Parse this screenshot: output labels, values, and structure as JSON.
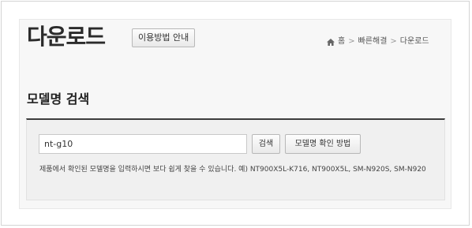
{
  "header": {
    "title": "다운로드",
    "guide_button": "이용방법 안내"
  },
  "breadcrumb": {
    "icon": "home-icon",
    "items": [
      "홈",
      "빠른해결",
      "다운로드"
    ],
    "separator": ">"
  },
  "section": {
    "title": "모델명 검색"
  },
  "search": {
    "value": "nt-g10",
    "search_button": "검색",
    "howto_button": "모델명 확인 방법",
    "hint": "제품에서 확인된 모델명을 입력하시면 보다 쉽게 찾을 수 있습니다. 예) NT900X5L-K716, NT900X5L, SM-N920S, SM-N920"
  }
}
